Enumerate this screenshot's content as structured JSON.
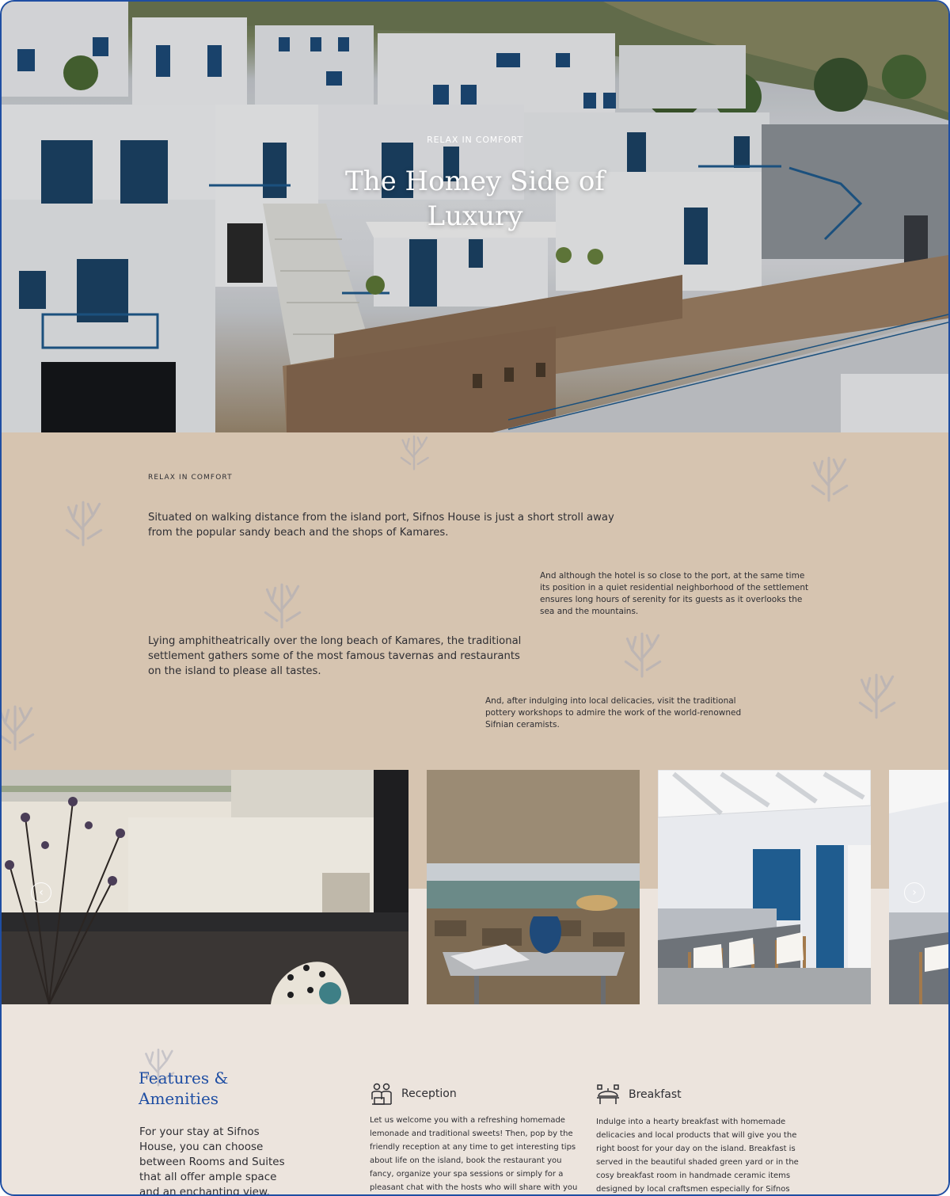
{
  "hero": {
    "eyebrow": "RELAX IN COMFORT",
    "title": "The Homey Side of Luxury"
  },
  "intro": {
    "eyebrow": "RELAX IN COMFORT",
    "paragraph_1": "Situated on walking distance from the island port, Sifnos House is just a short stroll away from the popular sandy beach and the shops of Kamares.",
    "paragraph_2": "And although the hotel is so close to the port, at the same time its position in a quiet residential neighborhood of the settlement ensures long hours of serenity for its guests as it overlooks the sea and the mountains.",
    "paragraph_3": "Lying amphitheatrically over the long beach of Kamares, the traditional settlement gathers some of the most famous tavernas and restaurants on the island to please all tastes.",
    "paragraph_4": "And, after indulging into local delicacies, visit the traditional pottery workshops to admire the work of the world-renowned Sifnian ceramists."
  },
  "gallery": {
    "prev_icon": "chevron-left-icon",
    "next_icon": "chevron-right-icon",
    "prev_glyph": "‹",
    "next_glyph": "›"
  },
  "features": {
    "title": "Features & Amenities",
    "intro": "For your stay at Sifnos House, you can choose between Rooms and Suites that all offer ample space and an enchanting view.",
    "items": [
      {
        "icon": "reception-icon",
        "label": "Reception",
        "text": "Let us welcome you with a refreshing homemade lemonade and traditional sweets! Then, pop by the friendly reception at any time to get interesting tips about life on the island, book the restaurant you fancy, organize your spa sessions or simply for a pleasant chat with the hosts who will share with you"
      },
      {
        "icon": "breakfast-icon",
        "label": "Breakfast",
        "text": "Indulge into a hearty breakfast with homemade delicacies and local products that will give you the right boost for your day on the island. Breakfast is served in the beautiful shaded green yard or in the cosy breakfast room in handmade ceramic items designed by local craftsmen especially for Sifnos"
      }
    ]
  },
  "colors": {
    "accent": "#1f4ea3",
    "sand": "#d6c4b0",
    "cream": "#ece4dd",
    "text": "#2e2e33"
  }
}
